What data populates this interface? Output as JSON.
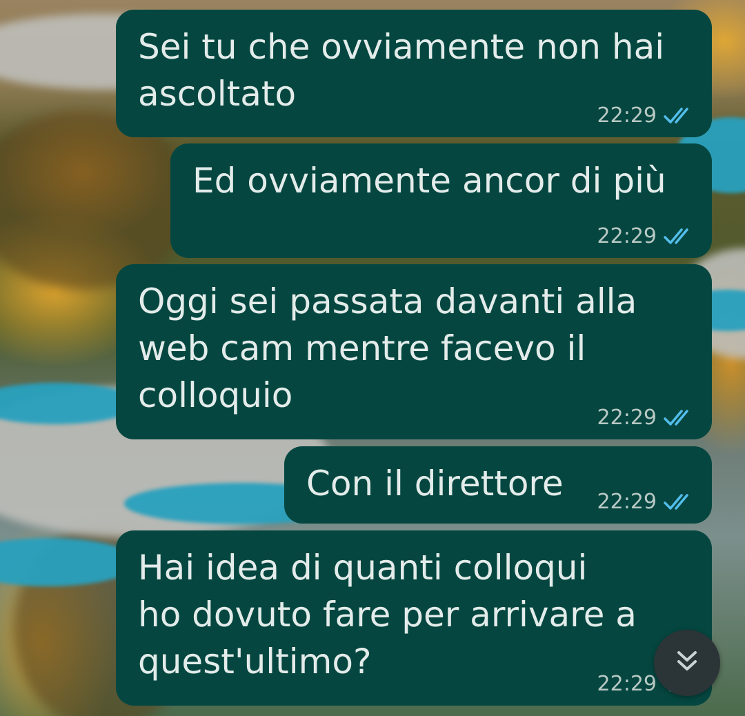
{
  "conversation": {
    "messages": [
      {
        "text": "Sei tu che ovviamente non hai\nascoltato",
        "time": "22:29",
        "status": "read-double-check"
      },
      {
        "text": "Ed ovviamente ancor di più",
        "time": "22:29",
        "status": "read-double-check"
      },
      {
        "text": "Oggi sei passata davanti alla\nweb cam mentre facevo il\ncolloquio",
        "time": "22:29",
        "status": "read-double-check"
      },
      {
        "text": "Con il direttore",
        "time": "22:29",
        "status": "read-double-check"
      },
      {
        "text": "Hai idea di quanti colloqui\nho dovuto fare per arrivare a\nquest'ultimo?",
        "time": "22:29",
        "status": "read-double-check"
      }
    ]
  },
  "controls": {
    "scroll_to_bottom_icon": "double-chevron-down-icon"
  },
  "theme": {
    "bubble_color": "#054740",
    "text_color": "#e3ecea",
    "time_color": "#b8c8c4",
    "read_tick_color": "#53bdeb"
  }
}
